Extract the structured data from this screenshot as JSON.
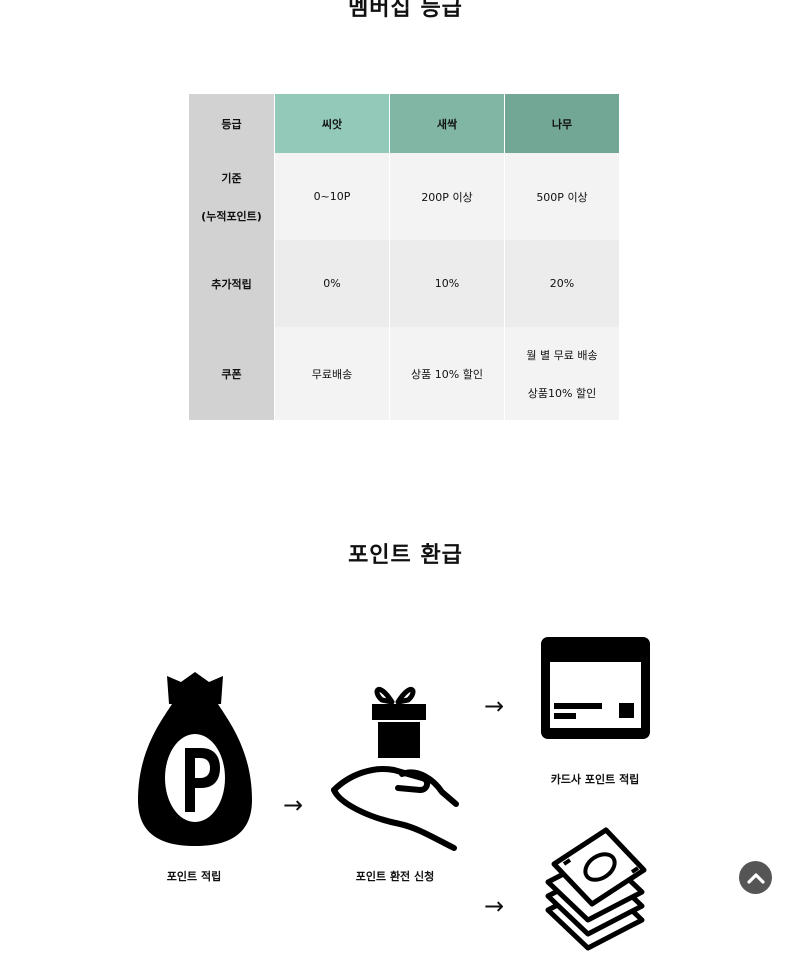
{
  "membership": {
    "title": "멤버십 등급",
    "table": {
      "header": [
        "등급",
        "씨앗",
        "새싹",
        "나무"
      ],
      "rows": [
        {
          "label_lines": [
            "기준",
            "(누적포인트)"
          ],
          "cells": [
            [
              "0~10P"
            ],
            [
              "200P 이상"
            ],
            [
              "500P 이상"
            ]
          ]
        },
        {
          "label_lines": [
            "추가적립"
          ],
          "cells": [
            [
              "0%"
            ],
            [
              "10%"
            ],
            [
              "20%"
            ]
          ]
        },
        {
          "label_lines": [
            "쿠폰"
          ],
          "cells": [
            [
              "무료배송"
            ],
            [
              "상품 10% 할인"
            ],
            [
              "월 별 무료 배송",
              "상품10% 할인"
            ]
          ]
        }
      ],
      "colors": {
        "header_seed": "#93c9b8",
        "header_sprout": "#80b6a3",
        "header_tree": "#72a796",
        "row_head": "#d2d2d2"
      }
    }
  },
  "refund": {
    "title": "포인트 환급",
    "steps": {
      "earn": {
        "caption": "포인트 적립",
        "icon": "money-bag-p-icon"
      },
      "apply": {
        "caption": "포인트 환전 신청",
        "icon": "gift-hand-icon"
      },
      "card": {
        "caption": "카드사 포인트 적립",
        "icon": "credit-card-icon"
      },
      "cash": {
        "icon": "cash-stack-icon"
      }
    },
    "arrow": "→"
  },
  "scroll_top": {
    "icon": "chevron-up-icon",
    "color": "#555555"
  }
}
